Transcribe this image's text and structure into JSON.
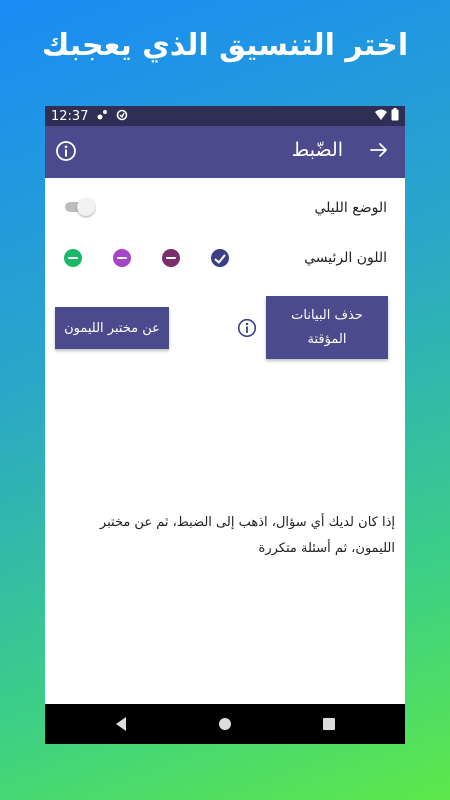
{
  "headline": "اختر التنسيق الذي يعجبك",
  "status_bar": {
    "time": "12:37"
  },
  "app_bar": {
    "title": "الضّبط"
  },
  "settings": {
    "night_mode_label": "الوضع الليلي",
    "night_mode_on": false,
    "primary_color_label": "اللون الرئيسي",
    "colors": [
      {
        "hex": "#3d3f86",
        "selected": true
      },
      {
        "hex": "#7b2d6e",
        "selected": false
      },
      {
        "hex": "#a645c8",
        "selected": false
      },
      {
        "hex": "#1bb86a",
        "selected": false
      }
    ]
  },
  "buttons": {
    "clear_cache_line1": "حذف البيانات",
    "clear_cache_line2": "المؤقتة",
    "about": "عن مختبر الليمون"
  },
  "help_text": "إذا كان لديك أي سؤال، اذهب إلى الضبط، ثم عن مختبر الليمون، ثم أسئلة متكررة",
  "icons": {
    "back": "arrow-back-icon",
    "info": "info-icon",
    "check": "check-icon",
    "nav_back": "triangle-back-icon",
    "nav_home": "circle-home-icon",
    "nav_recents": "square-recents-icon"
  },
  "theme": {
    "primary": "#4b4a8c",
    "status_bar": "#2f2f55"
  }
}
